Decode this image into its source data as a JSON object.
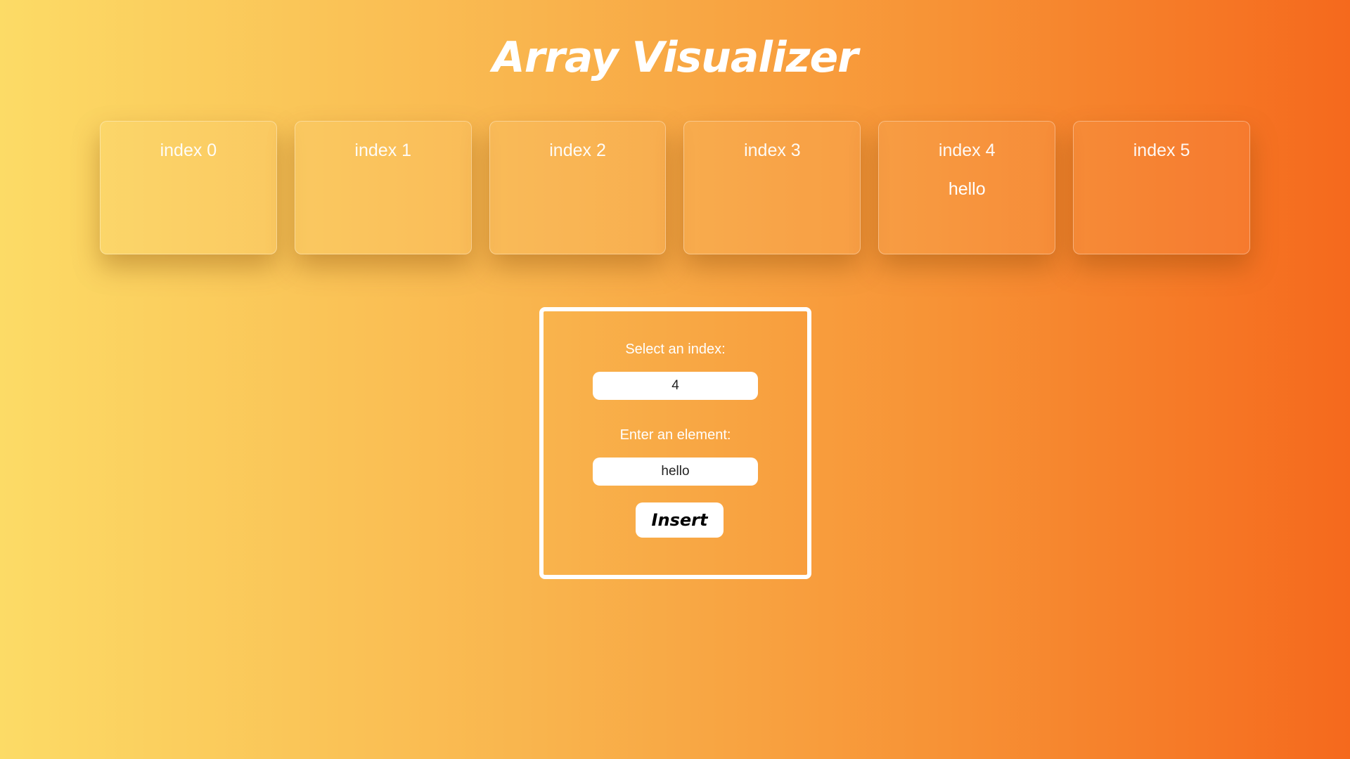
{
  "header": {
    "title": "Array Visualizer"
  },
  "array": {
    "cells": [
      {
        "label": "index 0",
        "value": ""
      },
      {
        "label": "index 1",
        "value": ""
      },
      {
        "label": "index 2",
        "value": ""
      },
      {
        "label": "index 3",
        "value": ""
      },
      {
        "label": "index 4",
        "value": "hello"
      },
      {
        "label": "index 5",
        "value": ""
      }
    ]
  },
  "form": {
    "index_label": "Select an index:",
    "index_value": "4",
    "element_label": "Enter an element:",
    "element_value": "hello",
    "insert_label": "Insert"
  },
  "colors": {
    "gradient_start": "#fcdb66",
    "gradient_end": "#f5691d",
    "text": "#ffffff"
  }
}
